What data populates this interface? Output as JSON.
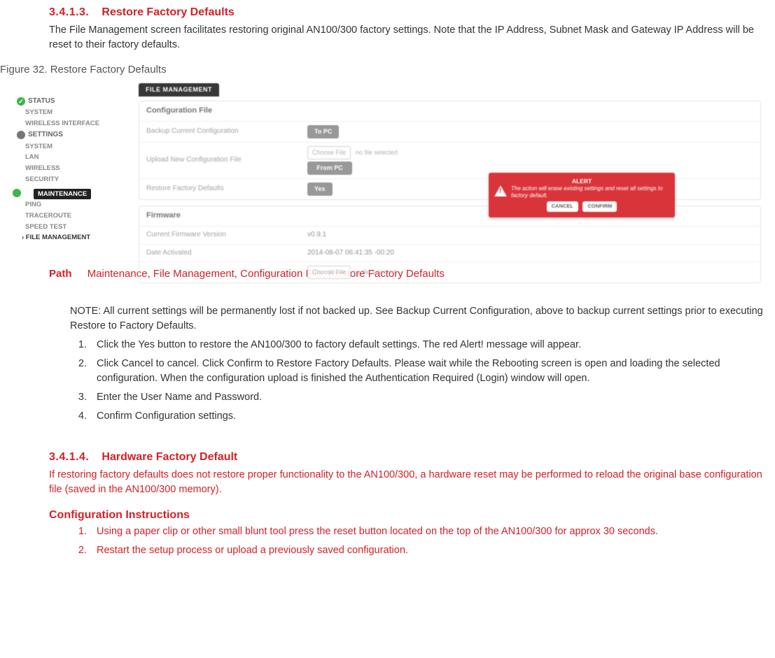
{
  "section1": {
    "num": "3.4.1.3.",
    "title": "Restore Factory Defaults",
    "body": "The File Management screen facilitates restoring original AN100/300 factory settings. Note that the IP Address, Subnet Mask and Gateway IP Address will be reset to their factory defaults."
  },
  "figure_caption": "Figure 32. Restore Factory Defaults",
  "ui": {
    "tab": "FILE MANAGEMENT",
    "sidebar": {
      "status": "STATUS",
      "status_subs": [
        "SYSTEM",
        "WIRELESS INTERFACE"
      ],
      "settings": "SETTINGS",
      "settings_subs": [
        "SYSTEM",
        "LAN",
        "WIRELESS",
        "SECURITY"
      ],
      "maintenance": "MAINTENANCE",
      "maintenance_subs": [
        "PING",
        "TRACEROUTE",
        "SPEED TEST"
      ],
      "file_mgmt": "› FILE MANAGEMENT"
    },
    "panel1": {
      "title": "Configuration File",
      "row1_label": "Backup Current Configuration",
      "row1_btn": "To PC",
      "row2_label": "Upload New Configuration File",
      "row2_choose": "Choose File",
      "row2_nofile": "no file selected",
      "row2_btn": "From PC",
      "row3_label": "Restore Factory Defaults",
      "row3_btn": "Yes"
    },
    "panel2": {
      "title": "Firmware",
      "row1_label": "Current Firmware Version",
      "row1_val": "v0.9.1",
      "row2_label": "Date Activated",
      "row2_val": "2014-08-07 06:41:35 -00:20",
      "row3_choose": "Choose File",
      "row3_nofile": "no file selected"
    },
    "alert": {
      "title": "ALERT",
      "body": "The action will erase existing settings and reset all settings to factory default.",
      "cancel": "CANCEL",
      "confirm": "CONFIRM"
    }
  },
  "path": {
    "label": "Path",
    "value": "Maintenance, File Management, Configuration File, Restore Factory Defaults"
  },
  "note": "NOTE: All current settings will be permanently lost if not backed up. See Backup Current Configuration, above to backup current settings prior to executing Restore to Factory Defaults.",
  "steps": [
    "Click the Yes button to restore the AN100/300 to factory default settings. The red Alert! message will appear.",
    "Click Cancel to cancel. Click Confirm to Restore Factory Defaults. Please wait while the Rebooting screen is open and loading the selected configuration. When the configuration upload is finished the Authentication Required (Login) window will open.",
    "Enter the User Name and Password.",
    "Confirm Configuration settings."
  ],
  "section2": {
    "num": "3.4.1.4.",
    "title": "Hardware Factory Default",
    "body": "If restoring factory defaults does not restore proper functionality to the AN100/300, a hardware reset may be performed to reload the original base configuration file (saved in the AN100/300 memory)."
  },
  "conf_title": "Configuration Instructions",
  "conf_steps": [
    "Using a paper clip or other small blunt tool press the reset button located on the top of the AN100/300 for approx 30 seconds.",
    "Restart the setup process or upload a previously saved configuration."
  ]
}
